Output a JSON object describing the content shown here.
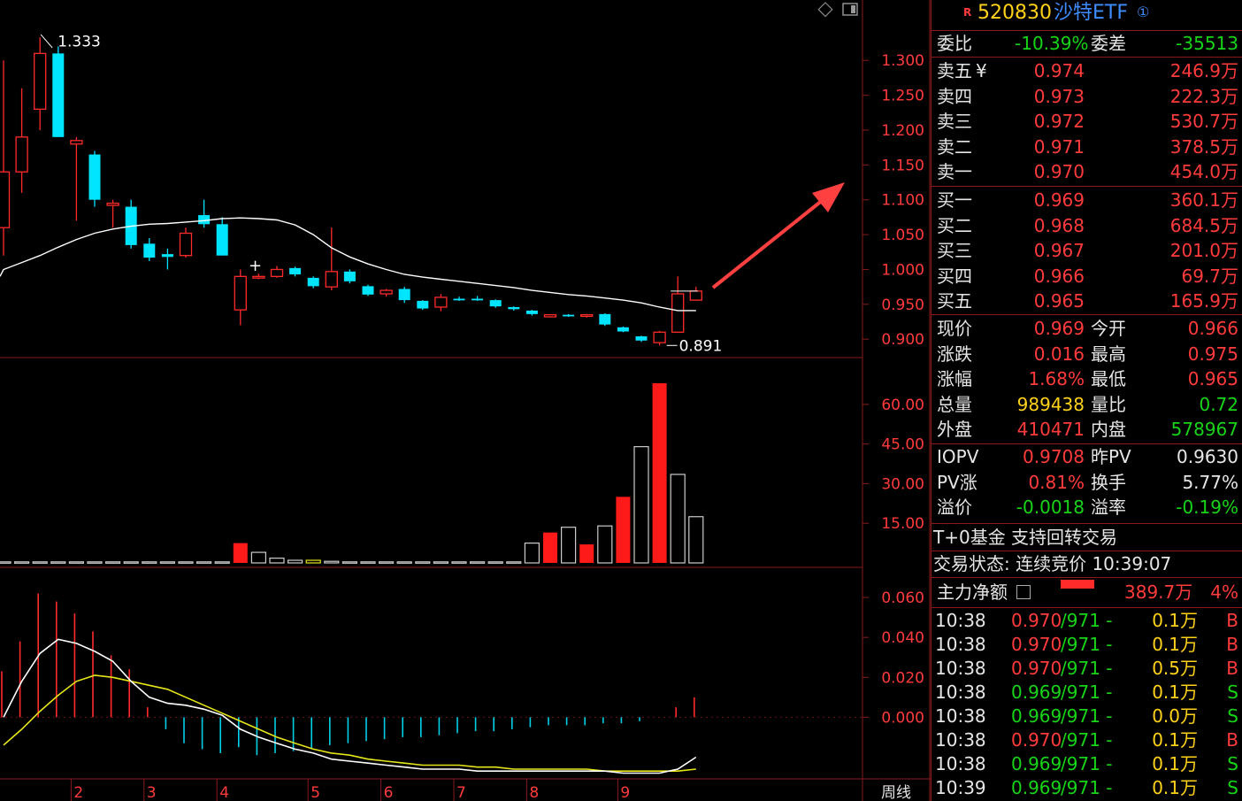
{
  "header": {
    "flag": "R",
    "code": "520830",
    "name": "沙特ETF",
    "circ": "①"
  },
  "summary": {
    "wb_label": "委比",
    "wb_value": "-10.39%",
    "wc_label": "委差",
    "wc_value": "-35513"
  },
  "asks": [
    {
      "label": "卖五",
      "sym": "¥",
      "price": "0.974",
      "vol": "246.9万"
    },
    {
      "label": "卖四",
      "price": "0.973",
      "vol": "222.3万"
    },
    {
      "label": "卖三",
      "price": "0.972",
      "vol": "530.7万"
    },
    {
      "label": "卖二",
      "price": "0.971",
      "vol": "378.5万"
    },
    {
      "label": "卖一",
      "price": "0.970",
      "vol": "454.0万"
    }
  ],
  "bids": [
    {
      "label": "买一",
      "price": "0.969",
      "vol": "360.1万"
    },
    {
      "label": "买二",
      "price": "0.968",
      "vol": "684.5万"
    },
    {
      "label": "买三",
      "price": "0.967",
      "vol": "201.0万"
    },
    {
      "label": "买四",
      "price": "0.966",
      "vol": "69.7万"
    },
    {
      "label": "买五",
      "price": "0.965",
      "vol": "165.9万"
    }
  ],
  "stats": [
    {
      "l1": "现价",
      "v1": "0.969",
      "c1": "red",
      "l2": "今开",
      "v2": "0.966",
      "c2": "red"
    },
    {
      "l1": "涨跌",
      "v1": "0.016",
      "c1": "red",
      "l2": "最高",
      "v2": "0.975",
      "c2": "red"
    },
    {
      "l1": "涨幅",
      "v1": "1.68%",
      "c1": "red",
      "l2": "最低",
      "v2": "0.965",
      "c2": "red"
    },
    {
      "l1": "总量",
      "v1": "989438",
      "c1": "yellow",
      "l2": "量比",
      "v2": "0.72",
      "c2": "green"
    },
    {
      "l1": "外盘",
      "v1": "410471",
      "c1": "red",
      "l2": "内盘",
      "v2": "578967",
      "c2": "green"
    }
  ],
  "stats2": [
    {
      "l1": "IOPV",
      "v1": "0.9708",
      "c1": "red",
      "l2": "昨PV",
      "v2": "0.9630",
      "c2": "white"
    },
    {
      "l1": "PV涨",
      "v1": "0.81%",
      "c1": "red",
      "l2": "换手",
      "v2": "5.77%",
      "c2": "white"
    },
    {
      "l1": "溢价",
      "v1": "-0.0018",
      "c1": "green",
      "l2": "溢率",
      "v2": "-0.19%",
      "c2": "green"
    }
  ],
  "fund_note": "T+0基金 支持回转交易",
  "trade_status": "交易状态: 连续竞价 10:39:07",
  "main_flow": {
    "label": "主力净额",
    "value": "389.7万",
    "pct": "4%"
  },
  "ticks": [
    {
      "time": "10:38",
      "price": "0.970",
      "ref": "/971 -",
      "vol": "0.1万",
      "side": "B"
    },
    {
      "time": "10:38",
      "price": "0.970",
      "ref": "/971 -",
      "vol": "0.1万",
      "side": "B"
    },
    {
      "time": "10:38",
      "price": "0.970",
      "ref": "/971 -",
      "vol": "0.5万",
      "side": "B"
    },
    {
      "time": "10:38",
      "price": "0.969",
      "ref": "/971 -",
      "vol": "0.1万",
      "side": "S"
    },
    {
      "time": "10:38",
      "price": "0.969",
      "ref": "/971 -",
      "vol": "0.0万",
      "side": "S"
    },
    {
      "time": "10:38",
      "price": "0.970",
      "ref": "/971 -",
      "vol": "0.1万",
      "side": "B"
    },
    {
      "time": "10:38",
      "price": "0.969",
      "ref": "/971 -",
      "vol": "0.1万",
      "side": "S"
    },
    {
      "time": "10:39",
      "price": "0.969",
      "ref": "/971 -",
      "vol": "0.1万",
      "side": "S"
    }
  ],
  "colors": {
    "up": "#ff2a2a",
    "down": "#00e5ff",
    "grid": "#8a1a1a",
    "axis_text": "#ff3b3b",
    "ma": "#ffffff",
    "dea": "#e6e61a"
  },
  "chart_data": {
    "type": "candlestick",
    "period_label": "周线",
    "price_axis_ticks": [
      "1.300",
      "1.250",
      "1.200",
      "1.150",
      "1.100",
      "1.050",
      "1.000",
      "0.950",
      "0.900"
    ],
    "price_ylim": [
      0.885,
      1.36
    ],
    "annotations": [
      {
        "text": "1.333",
        "type": "high"
      },
      {
        "text": "0.891",
        "type": "low"
      }
    ],
    "x_month_labels": [
      {
        "label": "2",
        "index": 4
      },
      {
        "label": "3",
        "index": 8
      },
      {
        "label": "4",
        "index": 12
      },
      {
        "label": "5",
        "index": 17
      },
      {
        "label": "6",
        "index": 21
      },
      {
        "label": "7",
        "index": 25
      },
      {
        "label": "8",
        "index": 29
      },
      {
        "label": "9",
        "index": 34
      }
    ],
    "candles": [
      {
        "o": 1.06,
        "h": 1.3,
        "l": 1.02,
        "c": 1.14
      },
      {
        "o": 1.14,
        "h": 1.26,
        "l": 1.11,
        "c": 1.19
      },
      {
        "o": 1.23,
        "h": 1.333,
        "l": 1.2,
        "c": 1.31
      },
      {
        "o": 1.31,
        "h": 1.32,
        "l": 1.19,
        "c": 1.19
      },
      {
        "o": 1.18,
        "h": 1.19,
        "l": 1.07,
        "c": 1.185
      },
      {
        "o": 1.165,
        "h": 1.17,
        "l": 1.09,
        "c": 1.1
      },
      {
        "o": 1.092,
        "h": 1.1,
        "l": 1.06,
        "c": 1.095
      },
      {
        "o": 1.09,
        "h": 1.1,
        "l": 1.03,
        "c": 1.035
      },
      {
        "o": 1.037,
        "h": 1.045,
        "l": 1.012,
        "c": 1.017
      },
      {
        "o": 1.022,
        "h": 1.03,
        "l": 1.0,
        "c": 1.018
      },
      {
        "o": 1.02,
        "h": 1.06,
        "l": 1.017,
        "c": 1.052
      },
      {
        "o": 1.078,
        "h": 1.1,
        "l": 1.06,
        "c": 1.065
      },
      {
        "o": 1.065,
        "h": 1.075,
        "l": 1.02,
        "c": 1.02
      },
      {
        "o": 0.942,
        "h": 1.0,
        "l": 0.92,
        "c": 0.99
      },
      {
        "o": 0.99,
        "h": 0.994,
        "l": 0.986,
        "c": 0.99
      },
      {
        "o": 0.99,
        "h": 1.005,
        "l": 0.988,
        "c": 1.0
      },
      {
        "o": 1.002,
        "h": 1.004,
        "l": 0.99,
        "c": 0.993
      },
      {
        "o": 0.988,
        "h": 0.99,
        "l": 0.973,
        "c": 0.976
      },
      {
        "o": 0.975,
        "h": 1.06,
        "l": 0.97,
        "c": 0.997
      },
      {
        "o": 0.997,
        "h": 1.0,
        "l": 0.98,
        "c": 0.983
      },
      {
        "o": 0.976,
        "h": 0.978,
        "l": 0.962,
        "c": 0.964
      },
      {
        "o": 0.965,
        "h": 0.972,
        "l": 0.961,
        "c": 0.97
      },
      {
        "o": 0.972,
        "h": 0.975,
        "l": 0.952,
        "c": 0.956
      },
      {
        "o": 0.955,
        "h": 0.956,
        "l": 0.942,
        "c": 0.944
      },
      {
        "o": 0.946,
        "h": 0.965,
        "l": 0.94,
        "c": 0.96
      },
      {
        "o": 0.958,
        "h": 0.961,
        "l": 0.955,
        "c": 0.957
      },
      {
        "o": 0.958,
        "h": 0.962,
        "l": 0.955,
        "c": 0.956
      },
      {
        "o": 0.956,
        "h": 0.957,
        "l": 0.945,
        "c": 0.947
      },
      {
        "o": 0.946,
        "h": 0.947,
        "l": 0.941,
        "c": 0.943
      },
      {
        "o": 0.941,
        "h": 0.942,
        "l": 0.934,
        "c": 0.936
      },
      {
        "o": 0.932,
        "h": 0.936,
        "l": 0.931,
        "c": 0.935
      },
      {
        "o": 0.935,
        "h": 0.936,
        "l": 0.932,
        "c": 0.934
      },
      {
        "o": 0.933,
        "h": 0.936,
        "l": 0.931,
        "c": 0.935
      },
      {
        "o": 0.936,
        "h": 0.937,
        "l": 0.919,
        "c": 0.921
      },
      {
        "o": 0.917,
        "h": 0.918,
        "l": 0.91,
        "c": 0.911
      },
      {
        "o": 0.904,
        "h": 0.905,
        "l": 0.896,
        "c": 0.898
      },
      {
        "o": 0.895,
        "h": 0.912,
        "l": 0.891,
        "c": 0.91
      },
      {
        "o": 0.91,
        "h": 0.99,
        "l": 0.91,
        "c": 0.965
      },
      {
        "o": 0.956,
        "h": 0.975,
        "l": 0.955,
        "c": 0.969
      }
    ],
    "ma_line": [
      1.0,
      1.01,
      1.02,
      1.032,
      1.043,
      1.052,
      1.058,
      1.062,
      1.065,
      1.066,
      1.068,
      1.07,
      1.073,
      1.074,
      1.073,
      1.071,
      1.064,
      1.05,
      1.031,
      1.018,
      1.008,
      1.0,
      0.993,
      0.989,
      0.986,
      0.983,
      0.98,
      0.977,
      0.974,
      0.97,
      0.967,
      0.964,
      0.962,
      0.959,
      0.956,
      0.952,
      0.946,
      0.941,
      0.941
    ],
    "volume_axis_ticks": [
      "60.00",
      "45.00",
      "30.00",
      "15.00"
    ],
    "volume_ylim": [
      0,
      68
    ],
    "volume": [
      0.4,
      0.4,
      0.4,
      0.4,
      0.4,
      0.4,
      0.4,
      0.4,
      0.4,
      0.4,
      0.4,
      0.4,
      0.4,
      7.5,
      4.0,
      1.8,
      1.0,
      1.0,
      0.6,
      0.4,
      0.4,
      0.4,
      0.4,
      0.4,
      0.4,
      0.4,
      0.4,
      0.4,
      0.4,
      7.5,
      11.5,
      13.5,
      7.0,
      14.0,
      25.0,
      44.0,
      68.0,
      33.5,
      17.5
    ],
    "volume_up": [
      false,
      false,
      false,
      false,
      false,
      false,
      false,
      false,
      false,
      false,
      false,
      false,
      false,
      true,
      false,
      false,
      false,
      false,
      false,
      false,
      false,
      false,
      false,
      false,
      false,
      false,
      false,
      false,
      false,
      false,
      true,
      false,
      true,
      false,
      true,
      false,
      true,
      false,
      false
    ],
    "macd_axis_ticks": [
      "0.060",
      "0.040",
      "0.020",
      "0.000"
    ],
    "macd_ylim": [
      -0.03,
      0.072
    ],
    "macd_hist": [
      0.023,
      0.038,
      0.062,
      0.058,
      0.052,
      0.043,
      0.031,
      0.024,
      0.005,
      -0.006,
      -0.013,
      -0.016,
      -0.018,
      -0.015,
      -0.019,
      -0.018,
      -0.017,
      -0.016,
      -0.014,
      -0.013,
      -0.012,
      -0.011,
      -0.01,
      -0.01,
      -0.009,
      -0.008,
      -0.007,
      -0.007,
      -0.006,
      -0.005,
      -0.004,
      -0.004,
      -0.004,
      -0.003,
      -0.003,
      -0.002,
      0.0,
      0.005,
      0.01
    ],
    "dif": [
      0.0,
      0.018,
      0.032,
      0.039,
      0.037,
      0.033,
      0.028,
      0.018,
      0.01,
      0.007,
      0.006,
      0.004,
      0.001,
      -0.006,
      -0.01,
      -0.013,
      -0.016,
      -0.018,
      -0.021,
      -0.022,
      -0.023,
      -0.024,
      -0.025,
      -0.026,
      -0.026,
      -0.026,
      -0.027,
      -0.027,
      -0.027,
      -0.027,
      -0.027,
      -0.027,
      -0.027,
      -0.027,
      -0.028,
      -0.028,
      -0.028,
      -0.026,
      -0.02
    ],
    "dea": [
      -0.014,
      -0.006,
      0.003,
      0.011,
      0.018,
      0.021,
      0.02,
      0.018,
      0.016,
      0.014,
      0.01,
      0.006,
      0.002,
      -0.002,
      -0.006,
      -0.01,
      -0.013,
      -0.016,
      -0.018,
      -0.019,
      -0.021,
      -0.022,
      -0.023,
      -0.024,
      -0.024,
      -0.024,
      -0.025,
      -0.025,
      -0.026,
      -0.026,
      -0.026,
      -0.026,
      -0.026,
      -0.027,
      -0.027,
      -0.027,
      -0.027,
      -0.027,
      -0.026
    ]
  }
}
